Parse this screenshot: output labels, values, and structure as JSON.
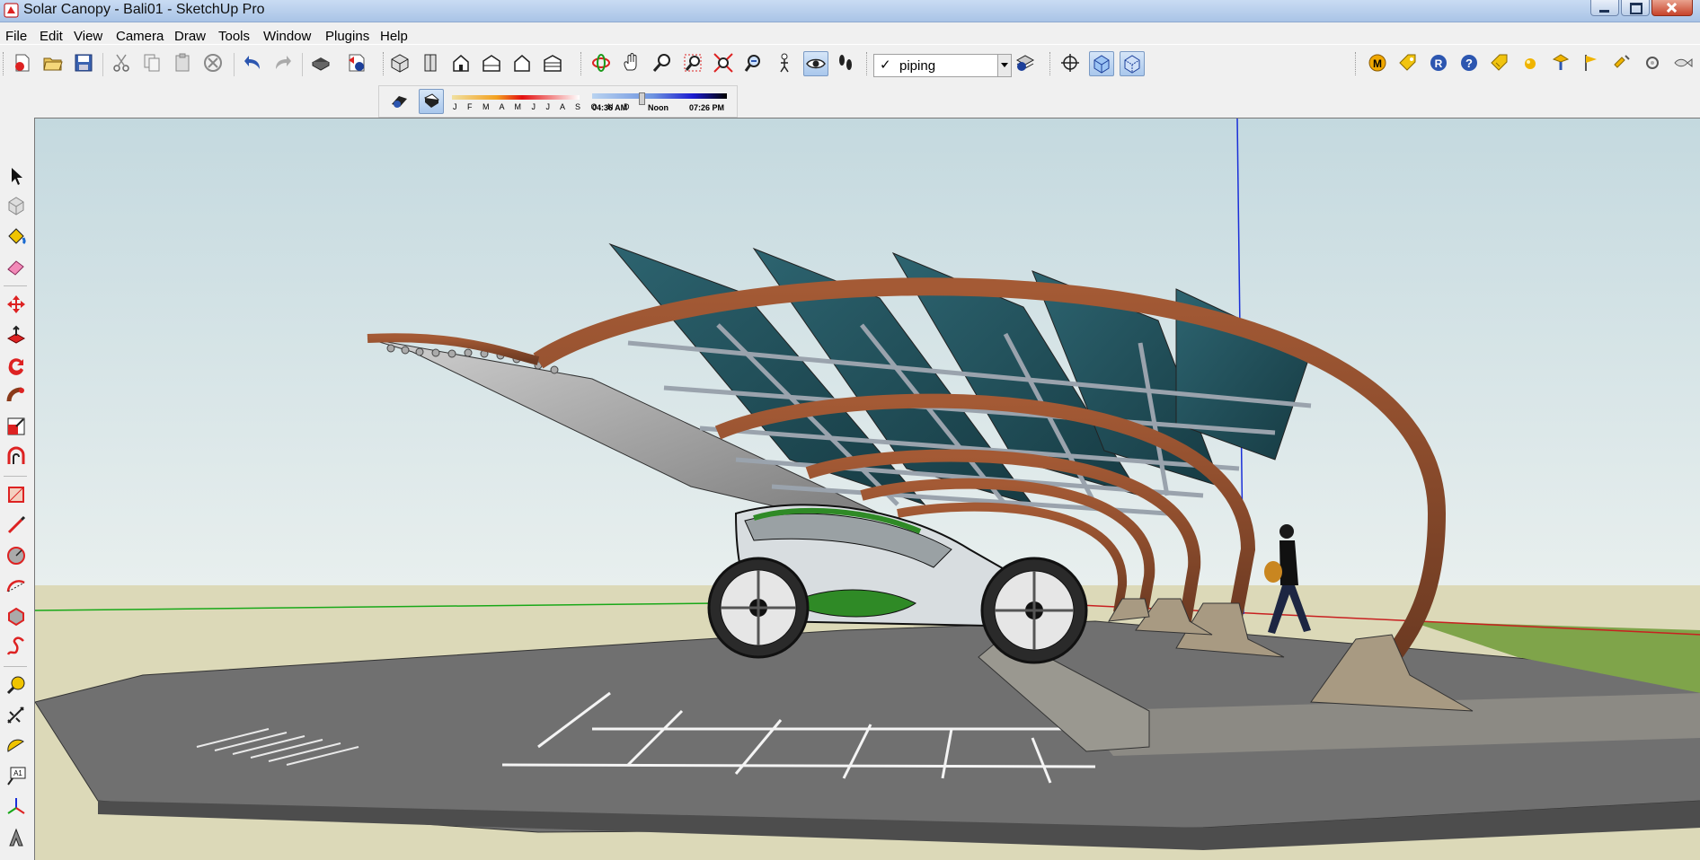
{
  "window": {
    "title": "Solar Canopy - Bali01 - SketchUp Pro"
  },
  "menu": [
    "File",
    "Edit",
    "View",
    "Camera",
    "Draw",
    "Tools",
    "Window",
    "Plugins",
    "Help"
  ],
  "layer": {
    "checked": "✓",
    "current": "piping"
  },
  "shadow": {
    "months": "J F M A M J J A S O N D",
    "time_start": "04:36 AM",
    "time_noon": "Noon",
    "time_end": "07:26 PM"
  },
  "icons": {
    "standard": [
      "new-icon",
      "open-icon",
      "save-icon",
      "cut-icon",
      "copy-icon",
      "paste-icon",
      "erase-icon",
      "undo-icon",
      "redo-icon",
      "print-icon",
      "model-info-icon"
    ],
    "views": [
      "iso-view-icon",
      "top-view-icon",
      "front-view-icon",
      "right-view-icon",
      "back-view-icon",
      "left-view-icon"
    ],
    "camera": [
      "orbit-icon",
      "pan-icon",
      "zoom-icon",
      "zoom-window-icon",
      "zoom-extents-icon",
      "previous-view-icon",
      "position-camera-icon",
      "look-around-icon",
      "walk-icon"
    ],
    "extras": [
      "layer-manager-icon",
      "axes-icon",
      "xray-icon",
      "back-edges-icon"
    ],
    "plugins": [
      "plugin-m-icon",
      "plugin-tag-icon",
      "plugin-r-icon",
      "help-icon",
      "plugin-tag2-icon",
      "sphere-icon",
      "plugin-beacon-icon",
      "plugin-flag-icon",
      "plugin-arrow-icon",
      "plugin-ring-icon",
      "plugin-fish-icon"
    ],
    "shadow_toolbar": [
      "shadow-settings-icon",
      "display-shadows-icon"
    ],
    "tools": [
      "select-icon",
      "make-component-icon",
      "paint-bucket-icon",
      "eraser-icon",
      "move-icon",
      "push-pull-icon",
      "rotate-icon",
      "follow-me-icon",
      "scale-icon",
      "offset-icon",
      "rectangle-icon",
      "line-icon",
      "circle-icon",
      "arc-icon",
      "polygon-icon",
      "freehand-icon",
      "tape-measure-icon",
      "dimension-icon",
      "protractor-icon",
      "text-icon",
      "axes-tool-icon",
      "3d-text-icon"
    ]
  },
  "colors": {
    "titlebar": "#b7cfee",
    "sky_top": "#c7dbe0",
    "sky_bottom": "#e4eeee",
    "ground": "#dad7b7",
    "canopy_arch": "#8a4a2a",
    "solar_panel": "#1f4a52",
    "car_accent": "#2f8a26",
    "blue_axis": "#1a2fd8",
    "green_axis": "#18a818",
    "red_axis": "#c82020"
  }
}
